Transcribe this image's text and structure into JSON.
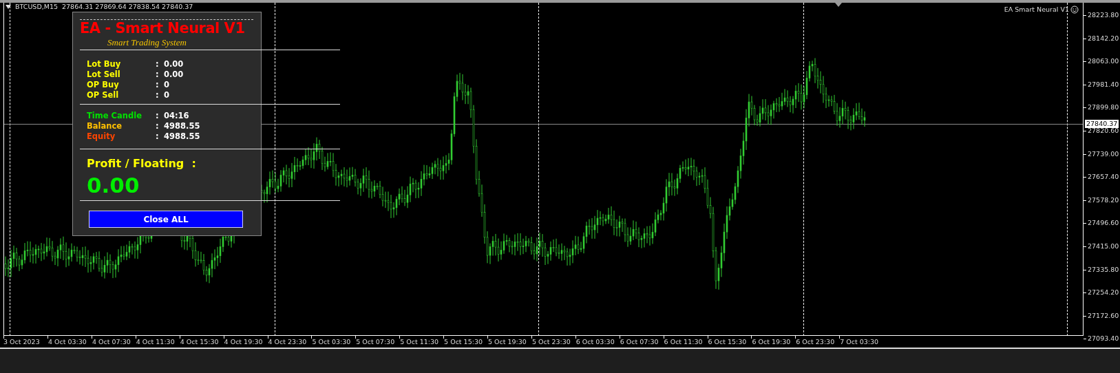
{
  "chart_header": {
    "symbol": "BTCUSD,M15",
    "ohlc": "27864.31 27869.64 27838.54 27840.37"
  },
  "expert": {
    "name": "EA Smart Neural V1"
  },
  "panel": {
    "title": "EA - Smart Neural V1",
    "subtitle": "Smart Trading System",
    "groups": [
      [
        {
          "label": "Lot Buy",
          "separator": ":",
          "value": "0.00",
          "color": "#ffff00"
        },
        {
          "label": "Lot Sell",
          "separator": ":",
          "value": "0.00",
          "color": "#ffff00"
        },
        {
          "label": "OP Buy",
          "separator": ":",
          "value": "0",
          "color": "#ffff00"
        },
        {
          "label": "OP Sell",
          "separator": ":",
          "value": "0",
          "color": "#ffff00"
        }
      ],
      [
        {
          "label": "Time Candle",
          "separator": ":",
          "value": "04:16",
          "color": "#00e000"
        },
        {
          "label": "Balance",
          "separator": ":",
          "value": "4988.55",
          "color": "#ffc000"
        },
        {
          "label": "Equity",
          "separator": ":",
          "value": "4988.55",
          "color": "#ff4500"
        }
      ]
    ],
    "profit_label": "Profit / Floating  :",
    "profit_value": "0.00",
    "button": "Close ALL"
  },
  "price_axis": {
    "labels": [
      "28223.80",
      "28142.20",
      "28063.00",
      "27981.40",
      "27899.80",
      "27820.60",
      "27739.00",
      "27657.40",
      "27578.20",
      "27496.60",
      "27415.00",
      "27335.80",
      "27254.20",
      "27172.60",
      "27093.40"
    ],
    "current_price": "27840.37"
  },
  "time_axis": {
    "labels": [
      "3 Oct 2023",
      "4 Oct 03:30",
      "4 Oct 07:30",
      "4 Oct 11:30",
      "4 Oct 15:30",
      "4 Oct 19:30",
      "4 Oct 23:30",
      "5 Oct 03:30",
      "5 Oct 07:30",
      "5 Oct 11:30",
      "5 Oct 15:30",
      "5 Oct 19:30",
      "5 Oct 23:30",
      "6 Oct 03:30",
      "6 Oct 07:30",
      "6 Oct 11:30",
      "6 Oct 15:30",
      "6 Oct 19:30",
      "6 Oct 23:30",
      "7 Oct 03:30"
    ]
  }
}
